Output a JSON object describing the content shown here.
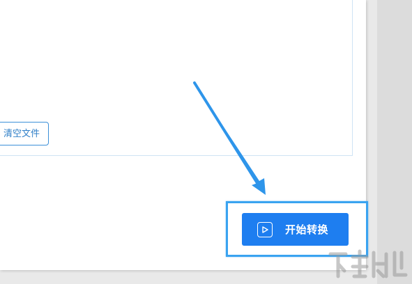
{
  "toolbar": {
    "clear_files_label": "清空文件",
    "start_convert_label": "开始转换"
  },
  "icons": {
    "start_button_icon": "play-icon",
    "annotation_arrow": "arrow-icon"
  },
  "colors": {
    "accent": "#1e7ef0",
    "highlight": "#3aa3f0",
    "clear_button_border": "#3b8fd8"
  }
}
